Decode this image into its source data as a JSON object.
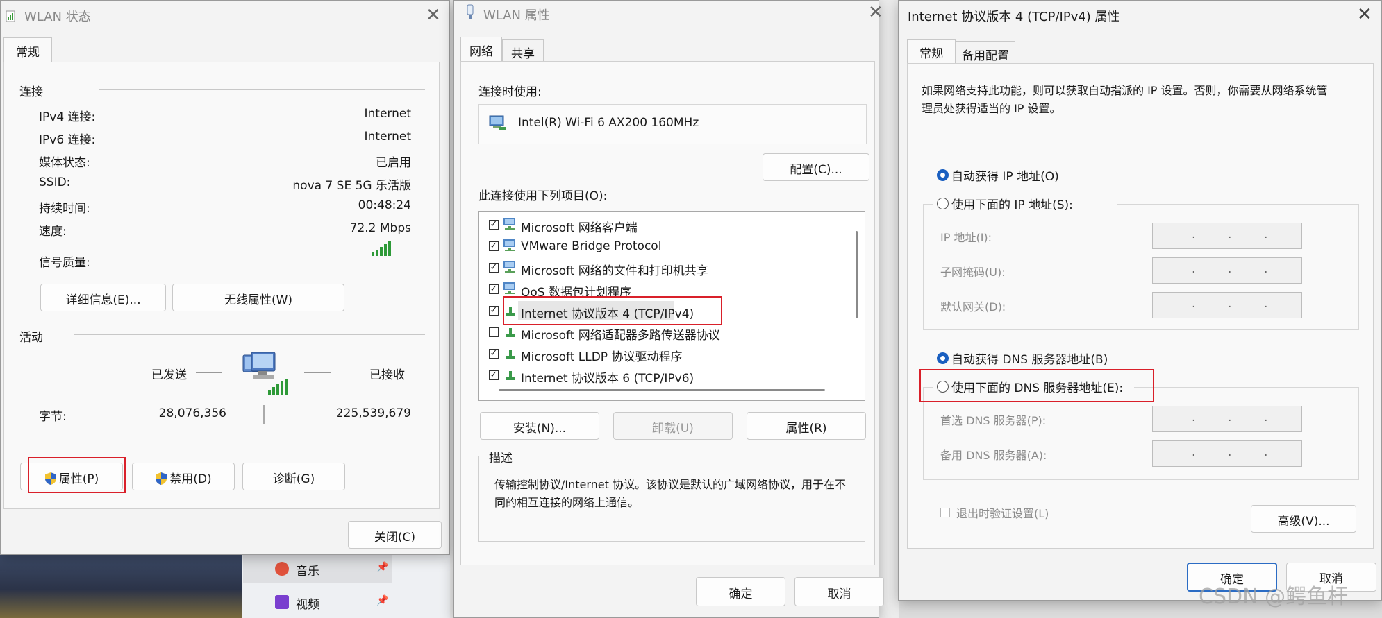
{
  "taskbar_items": [
    {
      "label": "音乐"
    },
    {
      "label": "视频"
    }
  ],
  "status": {
    "title": "WLAN 状态",
    "tab": "常规",
    "section_connection": "连接",
    "rows": [
      {
        "label": "IPv4 连接:",
        "value": "Internet"
      },
      {
        "label": "IPv6 连接:",
        "value": "Internet"
      },
      {
        "label": "媒体状态:",
        "value": "已启用"
      },
      {
        "label": "SSID:",
        "value": "nova 7 SE 5G 乐活版"
      },
      {
        "label": "持续时间:",
        "value": "00:48:24"
      },
      {
        "label": "速度:",
        "value": "72.2 Mbps"
      }
    ],
    "signal_label": "信号质量:",
    "signal_bars": 5,
    "details_button": "详细信息(E)...",
    "wireless_button": "无线属性(W)",
    "section_activity": "活动",
    "sent_label": "已发送",
    "received_label": "已接收",
    "bytes_label": "字节:",
    "bytes_sent": "28,076,356",
    "bytes_received": "225,539,679",
    "properties_button": "属性(P)",
    "disable_button": "禁用(D)",
    "diagnose_button": "诊断(G)",
    "close_button": "关闭(C)"
  },
  "props": {
    "title": "WLAN 属性",
    "tabs": [
      "网络",
      "共享"
    ],
    "connect_using_label": "连接时使用:",
    "adapter_name": "Intel(R) Wi-Fi 6 AX200 160MHz",
    "configure_button": "配置(C)...",
    "items_label": "此连接使用下列项目(O):",
    "items": [
      {
        "label": "Microsoft 网络客户端",
        "checked": true,
        "icon": "network-client-icon"
      },
      {
        "label": "VMware Bridge Protocol",
        "checked": true,
        "icon": "network-client-icon"
      },
      {
        "label": "Microsoft 网络的文件和打印机共享",
        "checked": true,
        "icon": "network-client-icon"
      },
      {
        "label": "QoS 数据包计划程序",
        "checked": true,
        "icon": "network-client-icon"
      },
      {
        "label": "Internet 协议版本 4 (TCP/IPv4)",
        "checked": true,
        "icon": "protocol-icon"
      },
      {
        "label": "Microsoft 网络适配器多路传送器协议",
        "checked": false,
        "icon": "protocol-icon"
      },
      {
        "label": "Microsoft LLDP 协议驱动程序",
        "checked": true,
        "icon": "protocol-icon"
      },
      {
        "label": "Internet 协议版本 6 (TCP/IPv6)",
        "checked": true,
        "icon": "protocol-icon"
      }
    ],
    "install_button": "安装(N)...",
    "uninstall_button": "卸载(U)",
    "properties_button": "属性(R)",
    "description_label": "描述",
    "description_text": "传输控制协议/Internet 协议。该协议是默认的广域网络协议，用于在不同的相互连接的网络上通信。",
    "ok_button": "确定",
    "cancel_button": "取消"
  },
  "ipv4": {
    "title": "Internet 协议版本 4 (TCP/IPv4) 属性",
    "tabs": [
      "常规",
      "备用配置"
    ],
    "intro": "如果网络支持此功能，则可以获取自动指派的 IP 设置。否则，你需要从网络系统管理员处获得适当的 IP 设置。",
    "auto_ip": "自动获得 IP 地址(O)",
    "manual_ip": "使用下面的 IP 地址(S):",
    "ip_address_label": "IP 地址(I):",
    "subnet_label": "子网掩码(U):",
    "gateway_label": "默认网关(D):",
    "auto_dns": "自动获得 DNS 服务器地址(B)",
    "manual_dns": "使用下面的 DNS 服务器地址(E):",
    "preferred_dns_label": "首选 DNS 服务器(P):",
    "alternate_dns_label": "备用 DNS 服务器(A):",
    "validate_label": "退出时验证设置(L)",
    "advanced_button": "高级(V)...",
    "ok_button": "确定",
    "cancel_button": "取消",
    "watermark": "CSDN @鳄鱼杆"
  }
}
